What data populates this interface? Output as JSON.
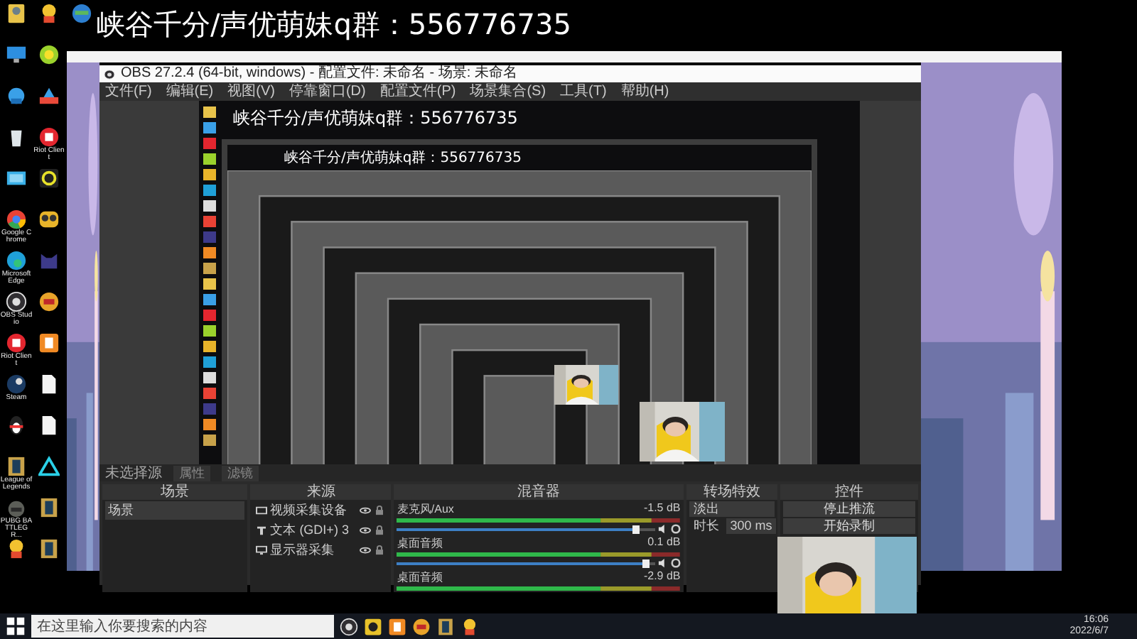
{
  "caption": "峡谷千分/声优萌妹q群：556776735",
  "desktop_columns": [
    [
      {
        "kind": "user"
      },
      {
        "kind": "monitor"
      },
      {
        "kind": "network"
      },
      {
        "kind": "recycle"
      },
      {
        "kind": "panel"
      },
      {
        "kind": "chrome",
        "label": "Google Chrome"
      },
      {
        "kind": "edge",
        "label": "Microsoft Edge"
      },
      {
        "kind": "obs",
        "label": "OBS Studio"
      },
      {
        "kind": "riot",
        "label": "Riot Client"
      },
      {
        "kind": "steam",
        "label": "Steam"
      },
      {
        "kind": "penguin"
      },
      {
        "kind": "lol",
        "label": "League of Legends"
      },
      {
        "kind": "helmet",
        "label": "PUBG BATTLEGR..."
      },
      {
        "kind": "racer"
      }
    ],
    [
      {
        "kind": "racer"
      },
      {
        "kind": "qq"
      },
      {
        "kind": "boat"
      },
      {
        "kind": "riot",
        "label": "Riot Client"
      },
      {
        "kind": "ring"
      },
      {
        "kind": "owl"
      },
      {
        "kind": "cat"
      },
      {
        "kind": "game"
      },
      {
        "kind": "orange"
      },
      {
        "kind": "doc"
      },
      {
        "kind": "doc"
      },
      {
        "kind": "triangle"
      },
      {
        "kind": "lol"
      },
      {
        "kind": "lol"
      }
    ],
    [
      {
        "kind": "globe"
      }
    ]
  ],
  "obs": {
    "title": "OBS 27.2.4 (64-bit, windows) - 配置文件: 未命名 - 场景: 未命名",
    "menu": [
      "文件(F)",
      "编辑(E)",
      "视图(V)",
      "停靠窗口(D)",
      "配置文件(P)",
      "场景集合(S)",
      "工具(T)",
      "帮助(H)"
    ],
    "preview": {
      "captions": [
        "峡谷千分/声优萌妹q群：556776735",
        "峡谷千分/声优萌妹q群：556776735"
      ]
    },
    "source_bar": {
      "label": "未选择源",
      "buttons": [
        "属性",
        "滤镜"
      ]
    },
    "docks": {
      "titles": [
        "场景",
        "来源",
        "混音器",
        "转场特效",
        "控件"
      ],
      "scenes": [
        {
          "label": "场景",
          "selected": true
        }
      ],
      "sources": [
        {
          "kind": "camera",
          "label": "视频采集设备"
        },
        {
          "kind": "text",
          "label": "文本 (GDI+) 3"
        },
        {
          "kind": "display",
          "label": "显示器采集"
        }
      ],
      "mixer": [
        {
          "name": "麦克风/Aux",
          "reading": "-1.5 dB",
          "level": 0.93
        },
        {
          "name": "桌面音频",
          "reading": "0.1 dB",
          "level": 0.97
        },
        {
          "name": "桌面音频",
          "reading": "-2.9 dB"
        }
      ],
      "transition": {
        "value": "淡出",
        "duration_label": "时长",
        "duration": "300 ms"
      },
      "controls": [
        "停止推流",
        "开始录制"
      ]
    }
  },
  "taskbar": {
    "search_placeholder": "在这里输入你要搜索的内容",
    "apps": [
      {
        "kind": "obs"
      },
      {
        "kind": "yy"
      },
      {
        "kind": "orange"
      },
      {
        "kind": "game"
      },
      {
        "kind": "lol"
      },
      {
        "kind": "racer"
      }
    ],
    "time": "16:06",
    "date": "2022/6/7"
  }
}
